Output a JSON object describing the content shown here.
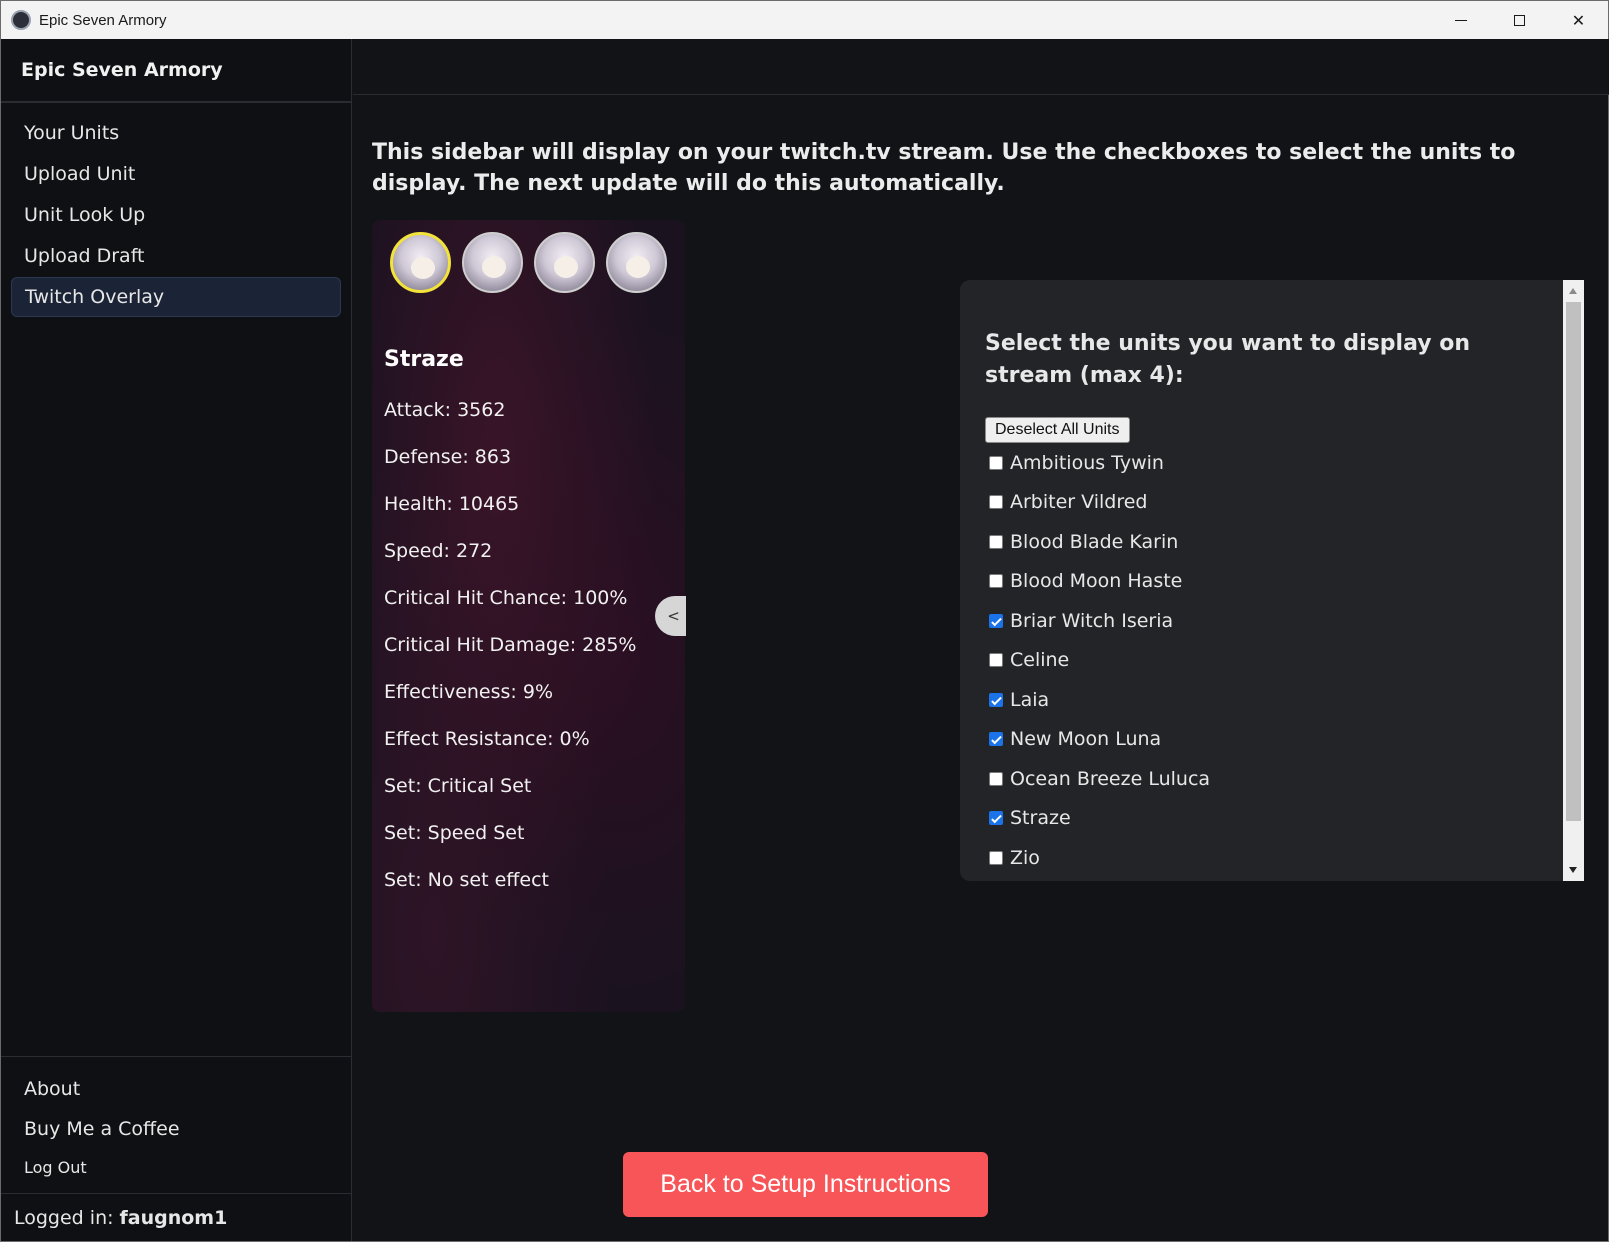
{
  "window": {
    "title": "Epic Seven Armory",
    "controls": [
      "minimize-icon",
      "maximize-icon",
      "close-icon"
    ]
  },
  "sidebar": {
    "brand": "Epic Seven Armory",
    "nav": [
      {
        "label": "Your Units"
      },
      {
        "label": "Upload Unit"
      },
      {
        "label": "Unit Look Up"
      },
      {
        "label": "Upload Draft"
      },
      {
        "label": "Twitch Overlay",
        "active": true
      }
    ],
    "bottom_links": [
      {
        "label": "About"
      },
      {
        "label": "Buy Me a Coffee"
      },
      {
        "label": "Log Out"
      }
    ],
    "logged_in_label": "Logged in:",
    "username": "faugnom1"
  },
  "main": {
    "intro": "This sidebar will display on your twitch.tv stream. Use the checkboxes to select the units to display. The next update will do this automatically.",
    "overlay": {
      "selected_unit": "Straze",
      "stats": [
        "Attack: 3562",
        "Defense: 863",
        "Health: 10465",
        "Speed: 272",
        "Critical Hit Chance: 100%",
        "Critical Hit Damage: 285%",
        "Effectiveness: 9%",
        "Effect Resistance: 0%",
        "Set: Critical Set",
        "Set: Speed Set",
        "Set: No set effect"
      ],
      "collapse_label": "<"
    },
    "selector": {
      "title": "Select the units you want to display on stream (max 4):",
      "deselect_label": "Deselect All Units",
      "units": [
        {
          "name": "Ambitious Tywin",
          "checked": false
        },
        {
          "name": "Arbiter Vildred",
          "checked": false
        },
        {
          "name": "Blood Blade Karin",
          "checked": false
        },
        {
          "name": "Blood Moon Haste",
          "checked": false
        },
        {
          "name": "Briar Witch Iseria",
          "checked": true
        },
        {
          "name": "Celine",
          "checked": false
        },
        {
          "name": "Laia",
          "checked": true
        },
        {
          "name": "New Moon Luna",
          "checked": true
        },
        {
          "name": "Ocean Breeze Luluca",
          "checked": false
        },
        {
          "name": "Straze",
          "checked": true
        },
        {
          "name": "Zio",
          "checked": false
        }
      ]
    },
    "back_button": "Back to Setup Instructions"
  }
}
